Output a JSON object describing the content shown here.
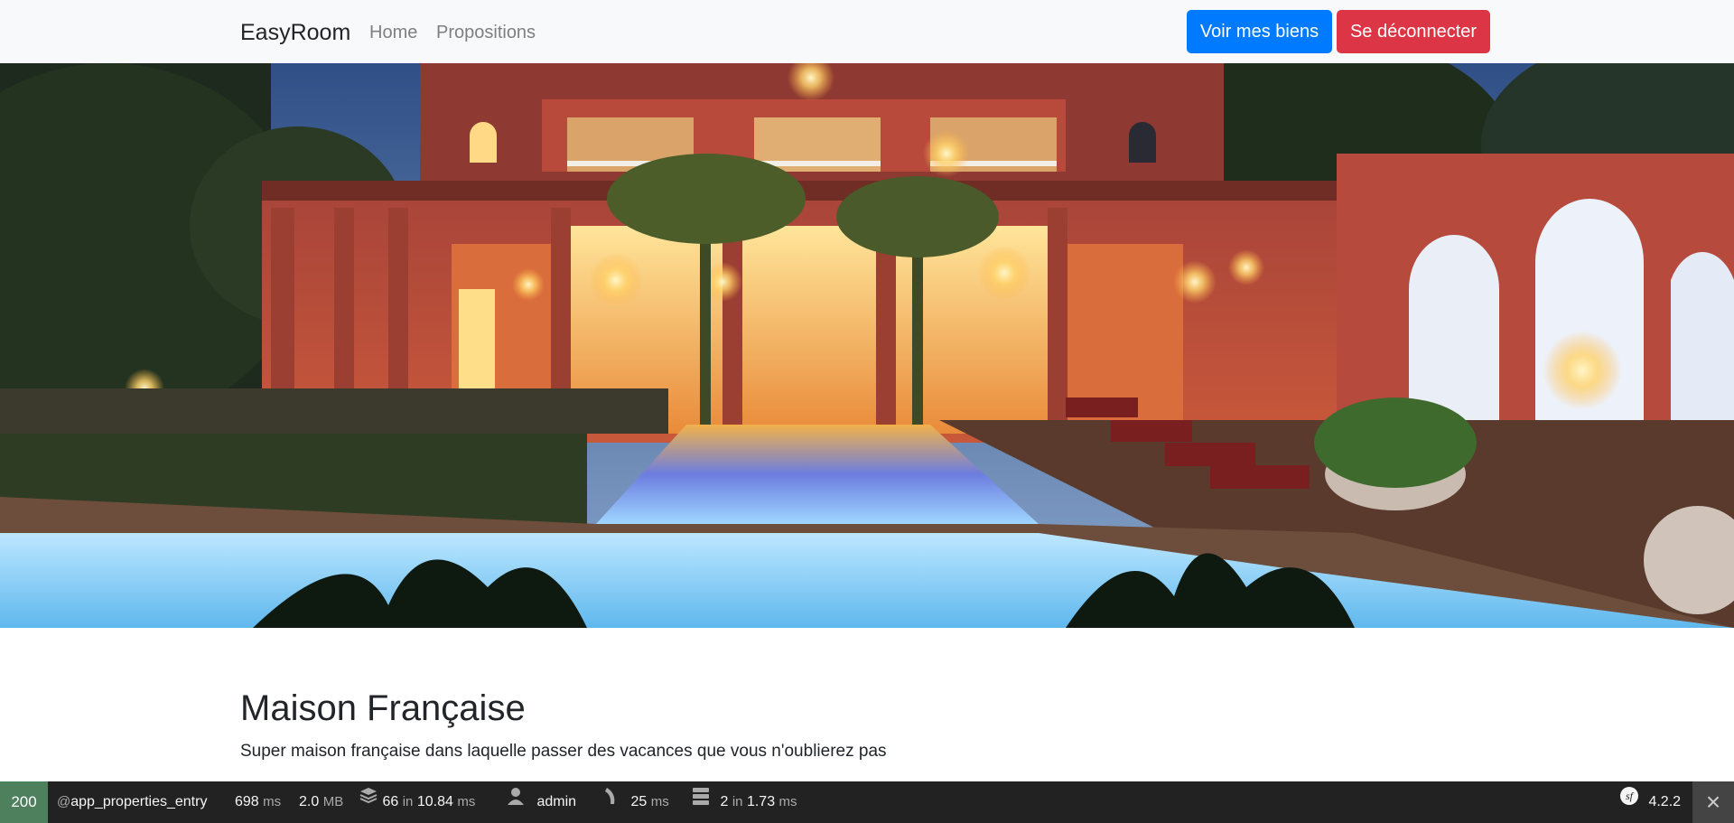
{
  "navbar": {
    "brand": "EasyRoom",
    "links": [
      "Home",
      "Propositions"
    ],
    "btn_properties": "Voir mes biens",
    "btn_logout": "Se déconnecter"
  },
  "property": {
    "title": "Maison Française",
    "description": "Super maison française dans laquelle passer des vacances que vous n'oublierez pas"
  },
  "toolbar": {
    "status": "200",
    "route_at": "@",
    "route": "app_properties_entry",
    "time_value": "698",
    "time_unit": "ms",
    "memory_value": "2.0",
    "memory_unit": "MB",
    "queries_count": "66",
    "queries_in": "in",
    "queries_time": "10.84",
    "queries_unit": "ms",
    "user": "admin",
    "events_value": "25",
    "events_unit": "ms",
    "cache_count": "2",
    "cache_in": "in",
    "cache_time": "1.73",
    "cache_unit": "ms",
    "version": "4.2.2",
    "close_icon": "×"
  },
  "colors": {
    "primary": "#007bff",
    "danger": "#dc3545",
    "status_ok": "#4f805d",
    "toolbar_bg": "#222222"
  }
}
